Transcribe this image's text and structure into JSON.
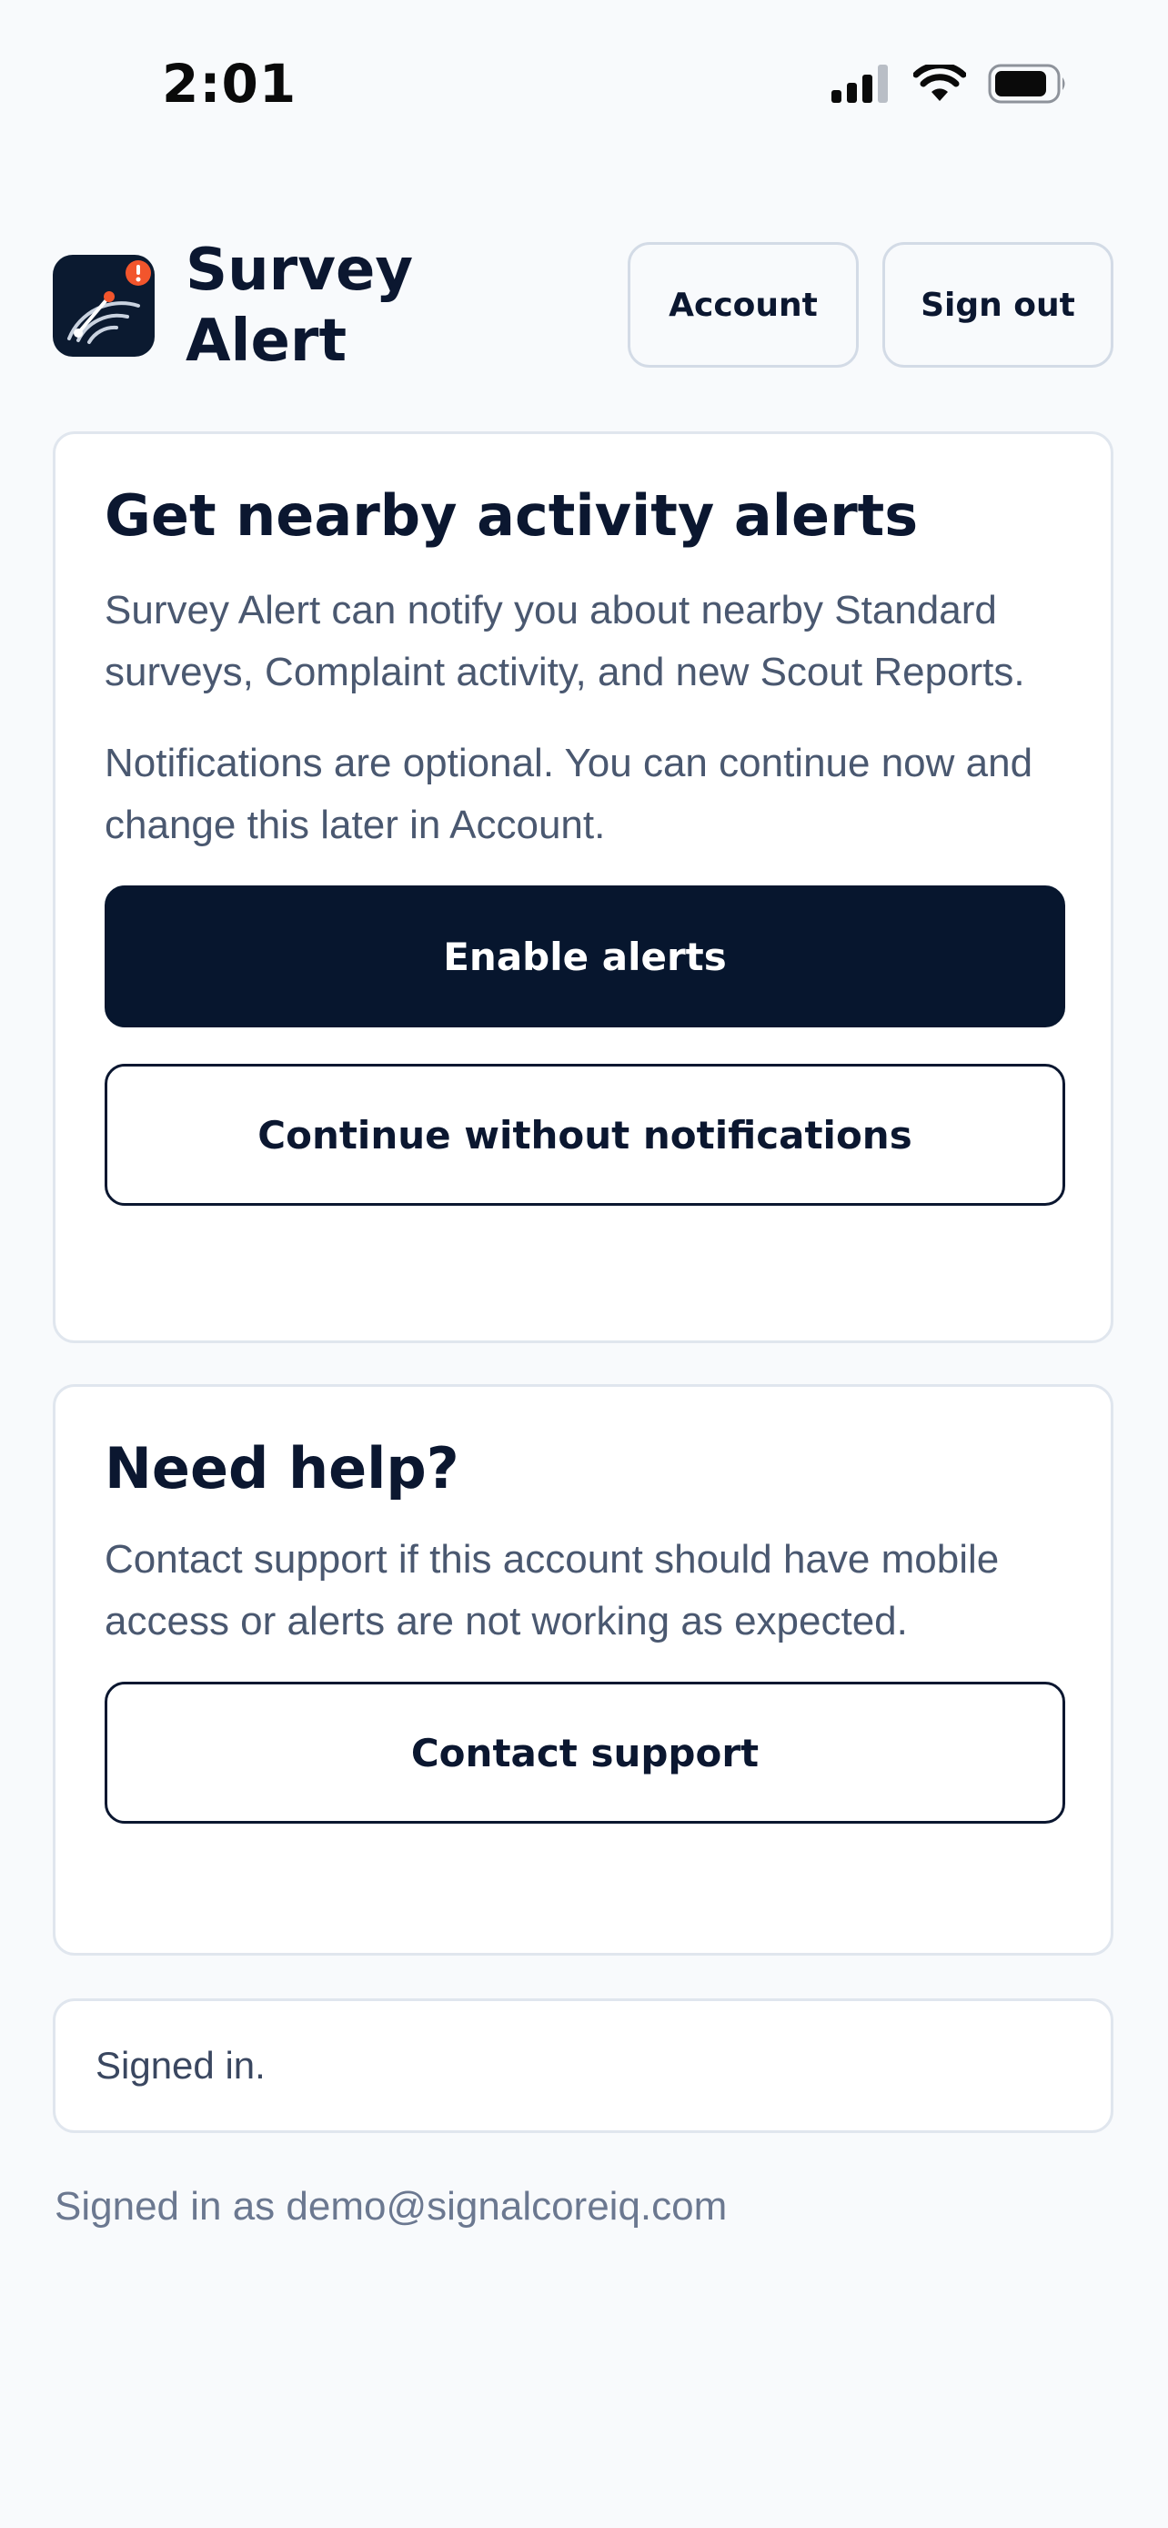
{
  "status_bar": {
    "time": "2:01"
  },
  "header": {
    "app_title": "Survey Alert",
    "account_label": "Account",
    "signout_label": "Sign out"
  },
  "alerts_card": {
    "title": "Get nearby activity alerts",
    "description": "Survey Alert can notify you about nearby Standard surveys, Complaint activity, and new Scout Reports.",
    "note": "Notifications are optional. You can continue now and change this later in Account.",
    "enable_label": "Enable alerts",
    "continue_label": "Continue without notifications"
  },
  "help_card": {
    "title": "Need help?",
    "description": "Contact support if this account should have mobile access or alerts are not working as expected.",
    "contact_label": "Contact support"
  },
  "status_message": "Signed in.",
  "footer": "Signed in as demo@signalcoreiq.com",
  "colors": {
    "primary": "#07162e",
    "background": "#f8fafc",
    "accent": "#f2552c",
    "text_muted": "#4a5870"
  },
  "icons": {
    "logo": "radar-alert-icon",
    "signal": "cellular-signal-icon",
    "wifi": "wifi-icon",
    "battery": "battery-icon"
  }
}
